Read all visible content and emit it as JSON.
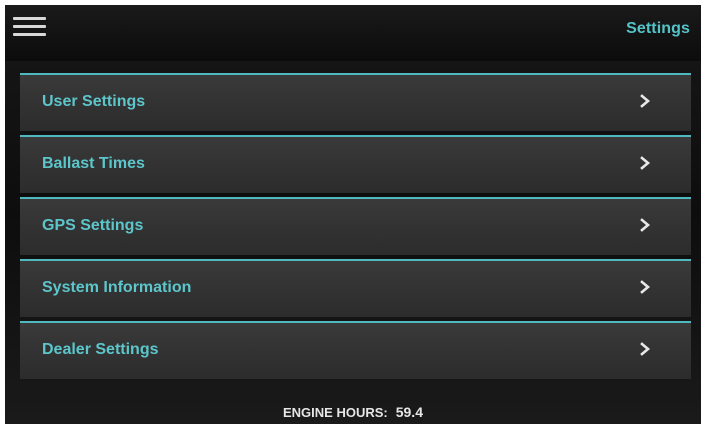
{
  "header": {
    "menu_icon": "hamburger-menu-icon",
    "title": "Settings"
  },
  "menu": {
    "items": [
      {
        "label": "User Settings",
        "icon": "chevron-right-icon"
      },
      {
        "label": "Ballast Times",
        "icon": "chevron-right-icon"
      },
      {
        "label": "GPS Settings",
        "icon": "chevron-right-icon"
      },
      {
        "label": "System Information",
        "icon": "chevron-right-icon"
      },
      {
        "label": "Dealer Settings",
        "icon": "chevron-right-icon"
      }
    ]
  },
  "footer": {
    "engine_hours_label": "ENGINE HOURS:",
    "engine_hours_value": "59.4"
  },
  "colors": {
    "accent": "#54c4c8",
    "background": "#111111",
    "item_background": "#333333",
    "footer_text": "#e6e6e6"
  }
}
